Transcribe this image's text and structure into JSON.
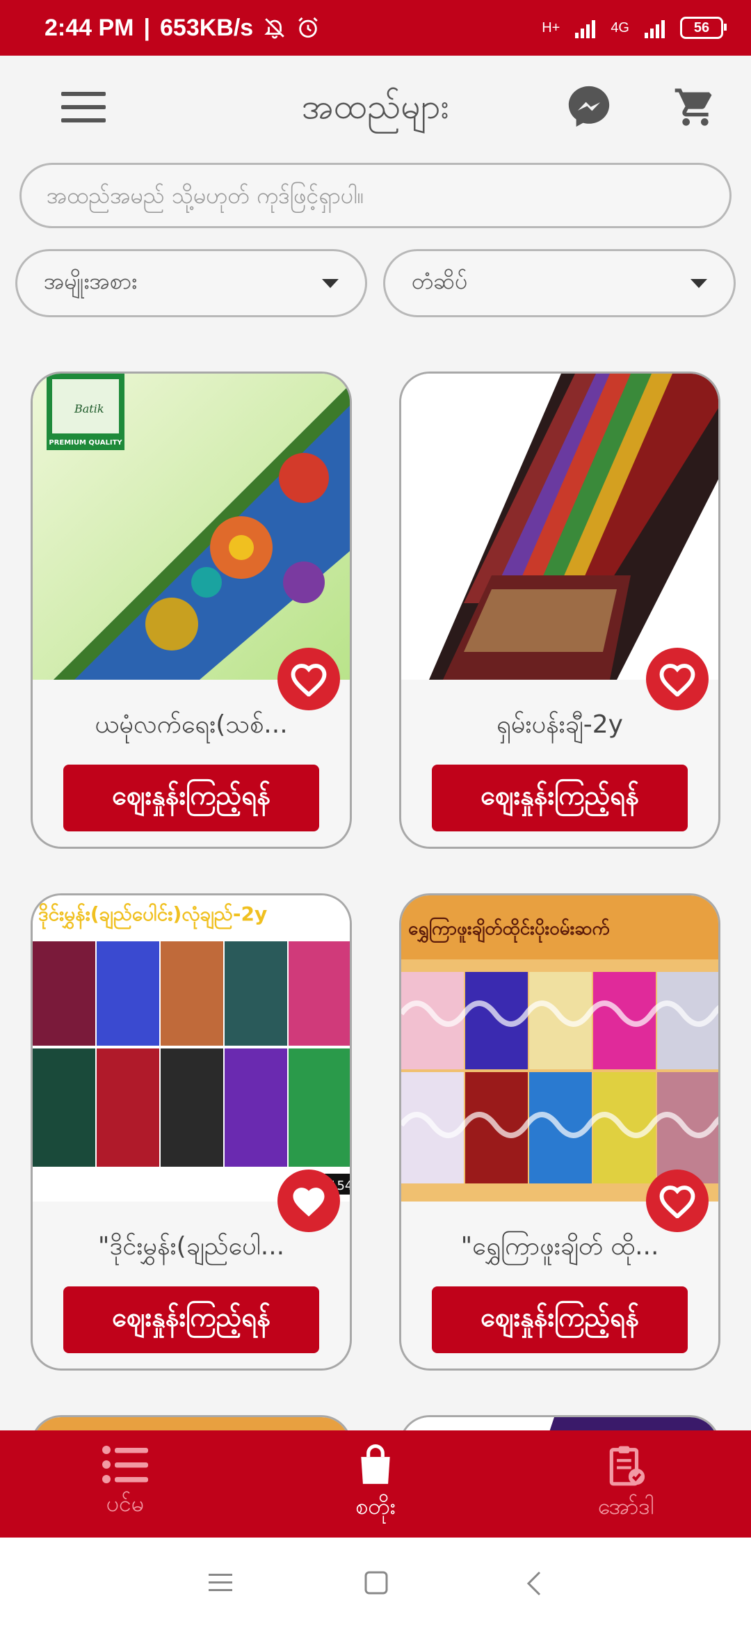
{
  "status_bar": {
    "time": "2:44 PM",
    "speed": "653KB/s",
    "network1": "H+",
    "network2": "4G",
    "battery": "56"
  },
  "header": {
    "title": "အထည်များ",
    "icons": [
      "menu-icon",
      "messenger-icon",
      "cart-icon"
    ]
  },
  "search": {
    "placeholder": "အထည်အမည် သို့မဟုတ် ကုဒ်ဖြင့်ရှာပါ။"
  },
  "filters": {
    "category": "အမျိုးအစား",
    "sort": "တံဆိပ်"
  },
  "products": [
    {
      "name": "ယမုံလက်ရေး(သစ်...",
      "button": "ဈေးနှုန်းကြည့်ရန်",
      "image_text": [
        "Batik",
        "PREMIUM QUALITY"
      ]
    },
    {
      "name": "ရှမ်းပန်းချီ-2y",
      "button": "ဈေးနှုန်းကြည့်ရန်"
    },
    {
      "name": "\"ဒိုင်းမွှန်း(ချည်ပေါ...",
      "button": "ဈေးနှုန်းကြည့်ရန်",
      "image_text": [
        "ဒိုင်းမွှန်း(ချည်ပေါင်း)လုံချည်-2y",
        "154"
      ]
    },
    {
      "name": "\"ရွှေကြာဖူးချိတ် ထို...",
      "button": "ဈေးနှုန်းကြည့်ရန်",
      "image_text": [
        "ရွှေကြာဖူးချိတ်ထိုင်းပိုးဝမ်းဆက်"
      ]
    }
  ],
  "bottom_nav": [
    {
      "label": "ပင်မ",
      "icon": "list-icon"
    },
    {
      "label": "စတိုး",
      "icon": "shopping-bag-icon"
    },
    {
      "label": "အော်ဒါ",
      "icon": "clipboard-check-icon"
    }
  ],
  "colors": {
    "primary": "#c0021a",
    "favorite": "#d9232e",
    "background": "#f4f4f4"
  }
}
